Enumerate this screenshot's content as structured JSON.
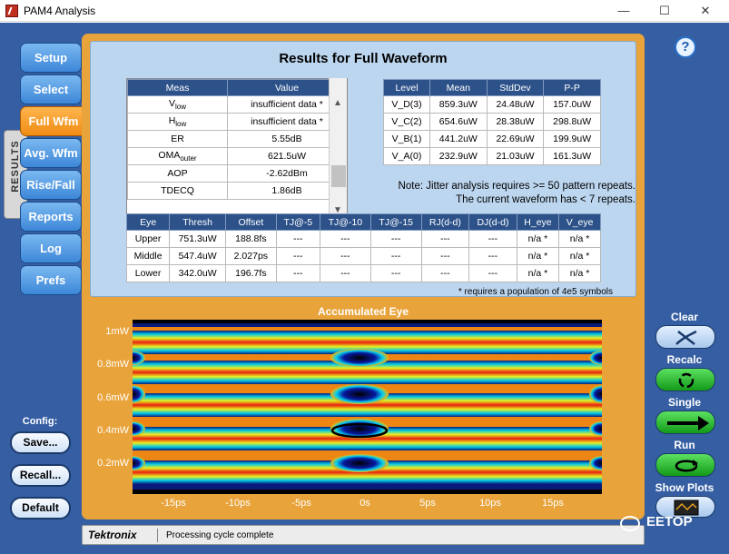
{
  "window": {
    "title": "PAM4 Analysis",
    "min": "—",
    "max": "☐",
    "close": "✕"
  },
  "sidebar": {
    "rail_label": "RESULTS",
    "tabs": [
      {
        "label": "Setup"
      },
      {
        "label": "Select"
      },
      {
        "label": "Full Wfm"
      },
      {
        "label": "Avg. Wfm"
      },
      {
        "label": "Rise/Fall"
      },
      {
        "label": "Reports"
      },
      {
        "label": "Log"
      },
      {
        "label": "Prefs"
      }
    ],
    "active_tab": "Full Wfm"
  },
  "results": {
    "title": "Results for Full Waveform",
    "meas_table": {
      "headers": [
        "Meas",
        "Value"
      ],
      "rows": [
        {
          "name": "V",
          "sub": "low",
          "value": "insufficient data *"
        },
        {
          "name": "H",
          "sub": "low",
          "value": "insufficient data *"
        },
        {
          "name": "ER",
          "sub": "",
          "value": "5.55dB"
        },
        {
          "name": "OMA",
          "sub": "outer",
          "value": "621.5uW"
        },
        {
          "name": "AOP",
          "sub": "",
          "value": "-2.62dBm"
        },
        {
          "name": "TDECQ",
          "sub": "",
          "value": "1.86dB"
        }
      ]
    },
    "level_table": {
      "headers": [
        "Level",
        "Mean",
        "StdDev",
        "P-P"
      ],
      "rows": [
        [
          "V_D(3)",
          "859.3uW",
          "24.48uW",
          "157.0uW"
        ],
        [
          "V_C(2)",
          "654.6uW",
          "28.38uW",
          "298.8uW"
        ],
        [
          "V_B(1)",
          "441.2uW",
          "22.69uW",
          "199.9uW"
        ],
        [
          "V_A(0)",
          "232.9uW",
          "21.03uW",
          "161.3uW"
        ]
      ]
    },
    "note_line1": "Note: Jitter analysis requires >= 50 pattern repeats.",
    "note_line2": "The current waveform has < 7 repeats.",
    "eye_table": {
      "headers": [
        "Eye",
        "Thresh",
        "Offset",
        "TJ@-5",
        "TJ@-10",
        "TJ@-15",
        "RJ(d-d)",
        "DJ(d-d)",
        "H_eye",
        "V_eye"
      ],
      "rows": [
        [
          "Upper",
          "751.3uW",
          "188.8fs",
          "---",
          "---",
          "---",
          "---",
          "---",
          "n/a *",
          "n/a *"
        ],
        [
          "Middle",
          "547.4uW",
          "2.027ps",
          "---",
          "---",
          "---",
          "---",
          "---",
          "n/a *",
          "n/a *"
        ],
        [
          "Lower",
          "342.0uW",
          "196.7fs",
          "---",
          "---",
          "---",
          "---",
          "---",
          "n/a *",
          "n/a *"
        ]
      ]
    },
    "footnote": "* requires a population of 4e5 symbols"
  },
  "plot": {
    "title": "Accumulated Eye",
    "y_ticks": [
      "1mW",
      "0.8mW",
      "0.6mW",
      "0.4mW",
      "0.2mW"
    ],
    "x_ticks": [
      "-15ps",
      "-10ps",
      "-5ps",
      "0s",
      "5ps",
      "10ps",
      "15ps"
    ]
  },
  "controls": {
    "help": "?",
    "clear": "Clear",
    "recalc": "Recalc",
    "single": "Single",
    "run": "Run",
    "show_plots": "Show Plots"
  },
  "config": {
    "label": "Config:",
    "save": "Save...",
    "recall": "Recall...",
    "default": "Default"
  },
  "status": {
    "brand": "Tektronix",
    "message": "Processing cycle complete"
  },
  "watermark": "EETOP"
}
